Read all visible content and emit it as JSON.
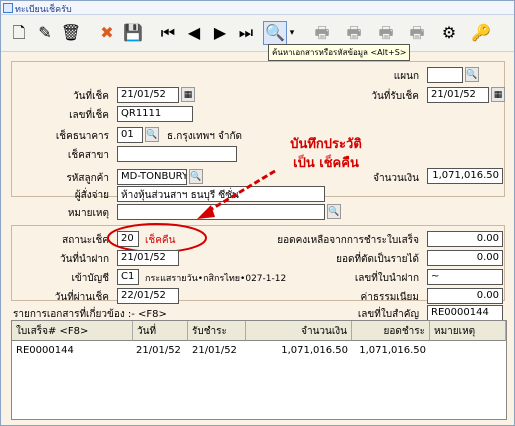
{
  "window": {
    "title": "ทะเบียนเช็ครับ"
  },
  "toolbar": {
    "icons": [
      "new-icon",
      "edit-icon",
      "trash-icon",
      "cancel-icon",
      "save-icon",
      "first-icon",
      "prev-icon",
      "next-icon",
      "last-icon",
      "search-icon",
      "dropdown-icon",
      "print-icon",
      "print-icon",
      "print-icon",
      "print-icon",
      "settings-icon",
      "key-icon"
    ],
    "tooltip": "ค้นหาเอกสารหรือรหัสข้อมูล <Alt+S>"
  },
  "form": {
    "branch_label": "แผนก",
    "branch_value": "",
    "cheque_date_label": "วันที่เช็ค",
    "cheque_date_value": "21/01/52",
    "receive_date_label": "วันที่รับเช็ค",
    "receive_date_value": "21/01/52",
    "cheque_no_label": "เลขที่เช็ค",
    "cheque_no_value": "QR1111",
    "bank_label": "เช็คธนาคาร",
    "bank_code": "01",
    "bank_name": "ธ.กรุงเทพฯ จำกัด",
    "bank_branch_label": "เช็คสาขา",
    "bank_branch_value": "",
    "customer_code_label": "รหัสลูกค้า",
    "customer_code_value": "MD-TONBURY",
    "amount_label": "จำนวนเงิน",
    "amount_value": "1,071,016.50",
    "payer_label": "ผู้สั่งจ่าย",
    "payer_value": "ห้างหุ้นส่วนสาฯ ธนบุรี ซีซั่น",
    "note_label": "หมายเหตุ",
    "note_value": "",
    "annotation_line1": "บันทึกประวัติ",
    "annotation_line2": "เป็น เช็คคืน",
    "status_label": "สถานะเช็ค",
    "status_code": "20",
    "status_text": "เช็คคืน",
    "deposit_date_label": "วันที่นำฝาก",
    "deposit_date_value": "21/01/52",
    "account_label": "เข้าบัญชี",
    "account_code": "C1",
    "account_name": "กระแสรายวัน•กสิกรไทย•027-1-12",
    "pass_date_label": "วันที่ผ่านเช็ค",
    "pass_date_value": "22/01/52",
    "balance_label": "ยอดคงเหลือจากการชำระใบเสร็จ",
    "balance_value": "0.00",
    "deducted_label": "ยอดที่ตัดเป็นรายได้",
    "deducted_value": "0.00",
    "deposit_no_label": "เลขที่ใบนำฝาก",
    "deposit_no_value": "~",
    "fee_label": "ค่าธรรมเนียม",
    "fee_value": "0.00",
    "ref_no_label": "เลขที่ใบสำคัญ",
    "ref_no_value": "RE0000144",
    "related_docs_label": "รายการเอกสารที่เกี่ยวข้อง :-  <F8>"
  },
  "grid": {
    "headers": [
      "ใบเสร็จ# <F8>",
      "วันที่",
      "รับชำระ",
      "จำนวนเงิน",
      "ยอดชำระ",
      "หมายเหตุ"
    ],
    "rows": [
      [
        "RE0000144",
        "21/01/52",
        "21/01/52",
        "1,071,016.50",
        "1,071,016.50",
        ""
      ]
    ]
  },
  "colors": {
    "annotation": "#d40000",
    "background": "#fbf2e6"
  }
}
